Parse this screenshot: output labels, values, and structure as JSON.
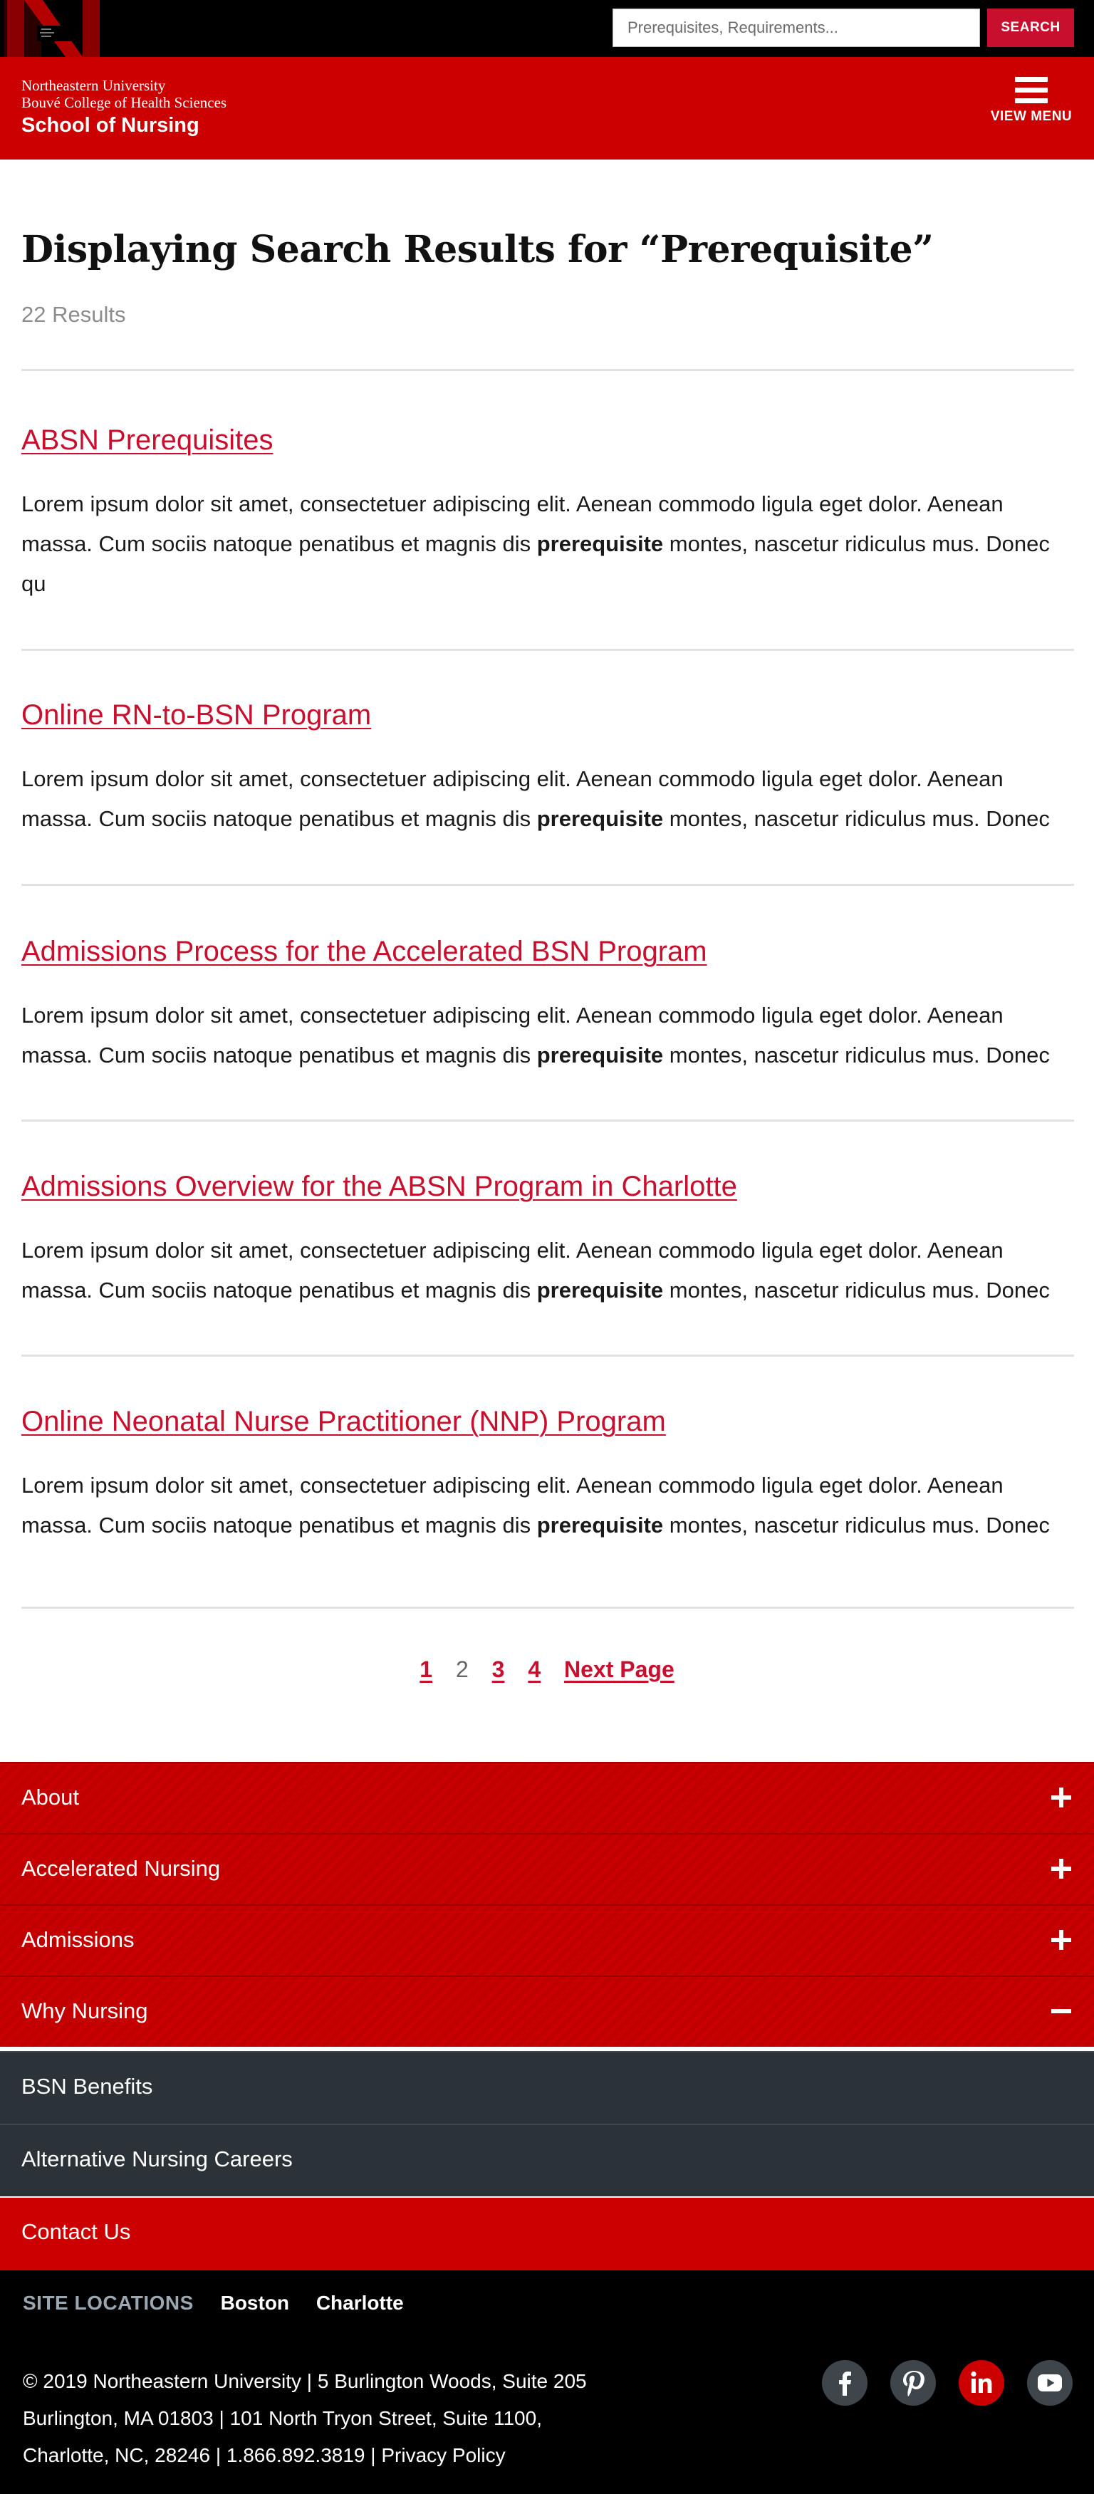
{
  "search": {
    "placeholder": "Prerequisites, Requirements...",
    "button_label": "SEARCH"
  },
  "header": {
    "line1": "Northeastern University",
    "line2": "Bouvé College of Health Sciences",
    "line3": "School of Nursing",
    "menu_label": "VIEW MENU"
  },
  "main": {
    "title": "Displaying Search Results for “Prerequisite”",
    "count": "22 Results",
    "results": [
      {
        "title": "ABSN Prerequisites",
        "before": "Lorem ipsum dolor sit amet, consectetuer adipiscing elit. Aenean commodo ligula eget dolor. Aenean massa. Cum sociis natoque penatibus et magnis dis ",
        "highlight": "prerequisite",
        "after": " montes, nascetur ridiculus mus. Donec qu"
      },
      {
        "title": "Online RN-to-BSN Program",
        "before": "Lorem ipsum dolor sit amet, consectetuer adipiscing elit. Aenean commodo ligula eget dolor. Aenean massa. Cum sociis natoque penatibus et magnis dis ",
        "highlight": "prerequisite",
        "after": " montes, nascetur ridiculus mus. Donec"
      },
      {
        "title": "Admissions Process for the Accelerated BSN Program",
        "before": "Lorem ipsum dolor sit amet, consectetuer adipiscing elit. Aenean commodo ligula eget dolor. Aenean massa. Cum sociis natoque penatibus et magnis dis ",
        "highlight": "prerequisite",
        "after": " montes, nascetur ridiculus mus. Donec"
      },
      {
        "title": "Admissions Overview for the ABSN Program in Charlotte",
        "before": "Lorem ipsum dolor sit amet, consectetuer adipiscing elit. Aenean commodo ligula eget dolor. Aenean massa. Cum sociis natoque penatibus et magnis dis ",
        "highlight": "prerequisite",
        "after": " montes, nascetur ridiculus mus. Donec"
      },
      {
        "title": "Online Neonatal Nurse Practitioner (NNP) Program",
        "before": "Lorem ipsum dolor sit amet, consectetuer adipiscing elit. Aenean commodo ligula eget dolor. Aenean massa. Cum sociis natoque penatibus et magnis dis ",
        "highlight": "prerequisite",
        "after": " montes, nascetur ridiculus mus. Donec"
      }
    ]
  },
  "pagination": {
    "p1": "1",
    "p2": "2",
    "p3": "3",
    "p4": "4",
    "current": 2,
    "next": "Next Page"
  },
  "footer_nav": {
    "about": "About",
    "accelerated": "Accelerated Nursing",
    "admissions": "Admissions",
    "why": "Why Nursing",
    "why_sub": [
      "BSN Benefits",
      "Alternative Nursing Careers"
    ],
    "contact": "Contact Us"
  },
  "footer": {
    "site_locations_label": "SITE LOCATIONS",
    "locations": [
      "Boston",
      "Charlotte"
    ],
    "address_line1": "© 2019 Northeastern University | 5 Burlington Woods, Suite 205",
    "address_line2": "Burlington, MA 01803 | 101 North Tryon Street, Suite 1100,",
    "address_line3_a": "Charlotte, NC, 28246 | 1.866.892.3819 | ",
    "privacy": "Privacy Policy",
    "social": [
      "facebook-icon",
      "pinterest-icon",
      "linkedin-icon",
      "youtube-icon"
    ]
  },
  "colors": {
    "brand_red": "#cc0000",
    "link_red": "#c8102e",
    "dark_slate": "#2b3338",
    "black": "#000000"
  }
}
